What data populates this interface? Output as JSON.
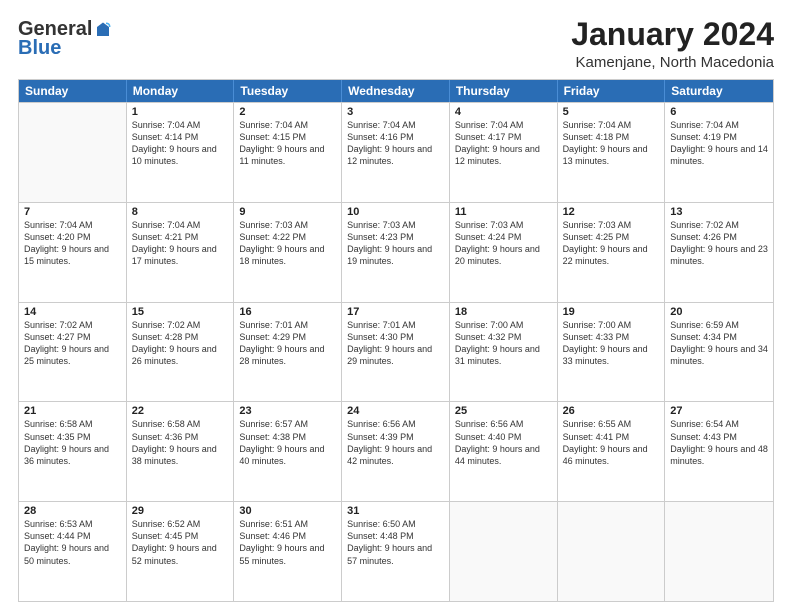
{
  "logo": {
    "general": "General",
    "blue": "Blue"
  },
  "header": {
    "month": "January 2024",
    "location": "Kamenjane, North Macedonia"
  },
  "days": [
    "Sunday",
    "Monday",
    "Tuesday",
    "Wednesday",
    "Thursday",
    "Friday",
    "Saturday"
  ],
  "weeks": [
    [
      {
        "day": "",
        "sunrise": "",
        "sunset": "",
        "daylight": "",
        "empty": true
      },
      {
        "day": "1",
        "sunrise": "Sunrise: 7:04 AM",
        "sunset": "Sunset: 4:14 PM",
        "daylight": "Daylight: 9 hours and 10 minutes."
      },
      {
        "day": "2",
        "sunrise": "Sunrise: 7:04 AM",
        "sunset": "Sunset: 4:15 PM",
        "daylight": "Daylight: 9 hours and 11 minutes."
      },
      {
        "day": "3",
        "sunrise": "Sunrise: 7:04 AM",
        "sunset": "Sunset: 4:16 PM",
        "daylight": "Daylight: 9 hours and 12 minutes."
      },
      {
        "day": "4",
        "sunrise": "Sunrise: 7:04 AM",
        "sunset": "Sunset: 4:17 PM",
        "daylight": "Daylight: 9 hours and 12 minutes."
      },
      {
        "day": "5",
        "sunrise": "Sunrise: 7:04 AM",
        "sunset": "Sunset: 4:18 PM",
        "daylight": "Daylight: 9 hours and 13 minutes."
      },
      {
        "day": "6",
        "sunrise": "Sunrise: 7:04 AM",
        "sunset": "Sunset: 4:19 PM",
        "daylight": "Daylight: 9 hours and 14 minutes."
      }
    ],
    [
      {
        "day": "7",
        "sunrise": "Sunrise: 7:04 AM",
        "sunset": "Sunset: 4:20 PM",
        "daylight": "Daylight: 9 hours and 15 minutes."
      },
      {
        "day": "8",
        "sunrise": "Sunrise: 7:04 AM",
        "sunset": "Sunset: 4:21 PM",
        "daylight": "Daylight: 9 hours and 17 minutes."
      },
      {
        "day": "9",
        "sunrise": "Sunrise: 7:03 AM",
        "sunset": "Sunset: 4:22 PM",
        "daylight": "Daylight: 9 hours and 18 minutes."
      },
      {
        "day": "10",
        "sunrise": "Sunrise: 7:03 AM",
        "sunset": "Sunset: 4:23 PM",
        "daylight": "Daylight: 9 hours and 19 minutes."
      },
      {
        "day": "11",
        "sunrise": "Sunrise: 7:03 AM",
        "sunset": "Sunset: 4:24 PM",
        "daylight": "Daylight: 9 hours and 20 minutes."
      },
      {
        "day": "12",
        "sunrise": "Sunrise: 7:03 AM",
        "sunset": "Sunset: 4:25 PM",
        "daylight": "Daylight: 9 hours and 22 minutes."
      },
      {
        "day": "13",
        "sunrise": "Sunrise: 7:02 AM",
        "sunset": "Sunset: 4:26 PM",
        "daylight": "Daylight: 9 hours and 23 minutes."
      }
    ],
    [
      {
        "day": "14",
        "sunrise": "Sunrise: 7:02 AM",
        "sunset": "Sunset: 4:27 PM",
        "daylight": "Daylight: 9 hours and 25 minutes."
      },
      {
        "day": "15",
        "sunrise": "Sunrise: 7:02 AM",
        "sunset": "Sunset: 4:28 PM",
        "daylight": "Daylight: 9 hours and 26 minutes."
      },
      {
        "day": "16",
        "sunrise": "Sunrise: 7:01 AM",
        "sunset": "Sunset: 4:29 PM",
        "daylight": "Daylight: 9 hours and 28 minutes."
      },
      {
        "day": "17",
        "sunrise": "Sunrise: 7:01 AM",
        "sunset": "Sunset: 4:30 PM",
        "daylight": "Daylight: 9 hours and 29 minutes."
      },
      {
        "day": "18",
        "sunrise": "Sunrise: 7:00 AM",
        "sunset": "Sunset: 4:32 PM",
        "daylight": "Daylight: 9 hours and 31 minutes."
      },
      {
        "day": "19",
        "sunrise": "Sunrise: 7:00 AM",
        "sunset": "Sunset: 4:33 PM",
        "daylight": "Daylight: 9 hours and 33 minutes."
      },
      {
        "day": "20",
        "sunrise": "Sunrise: 6:59 AM",
        "sunset": "Sunset: 4:34 PM",
        "daylight": "Daylight: 9 hours and 34 minutes."
      }
    ],
    [
      {
        "day": "21",
        "sunrise": "Sunrise: 6:58 AM",
        "sunset": "Sunset: 4:35 PM",
        "daylight": "Daylight: 9 hours and 36 minutes."
      },
      {
        "day": "22",
        "sunrise": "Sunrise: 6:58 AM",
        "sunset": "Sunset: 4:36 PM",
        "daylight": "Daylight: 9 hours and 38 minutes."
      },
      {
        "day": "23",
        "sunrise": "Sunrise: 6:57 AM",
        "sunset": "Sunset: 4:38 PM",
        "daylight": "Daylight: 9 hours and 40 minutes."
      },
      {
        "day": "24",
        "sunrise": "Sunrise: 6:56 AM",
        "sunset": "Sunset: 4:39 PM",
        "daylight": "Daylight: 9 hours and 42 minutes."
      },
      {
        "day": "25",
        "sunrise": "Sunrise: 6:56 AM",
        "sunset": "Sunset: 4:40 PM",
        "daylight": "Daylight: 9 hours and 44 minutes."
      },
      {
        "day": "26",
        "sunrise": "Sunrise: 6:55 AM",
        "sunset": "Sunset: 4:41 PM",
        "daylight": "Daylight: 9 hours and 46 minutes."
      },
      {
        "day": "27",
        "sunrise": "Sunrise: 6:54 AM",
        "sunset": "Sunset: 4:43 PM",
        "daylight": "Daylight: 9 hours and 48 minutes."
      }
    ],
    [
      {
        "day": "28",
        "sunrise": "Sunrise: 6:53 AM",
        "sunset": "Sunset: 4:44 PM",
        "daylight": "Daylight: 9 hours and 50 minutes."
      },
      {
        "day": "29",
        "sunrise": "Sunrise: 6:52 AM",
        "sunset": "Sunset: 4:45 PM",
        "daylight": "Daylight: 9 hours and 52 minutes."
      },
      {
        "day": "30",
        "sunrise": "Sunrise: 6:51 AM",
        "sunset": "Sunset: 4:46 PM",
        "daylight": "Daylight: 9 hours and 55 minutes."
      },
      {
        "day": "31",
        "sunrise": "Sunrise: 6:50 AM",
        "sunset": "Sunset: 4:48 PM",
        "daylight": "Daylight: 9 hours and 57 minutes."
      },
      {
        "day": "",
        "sunrise": "",
        "sunset": "",
        "daylight": "",
        "empty": true
      },
      {
        "day": "",
        "sunrise": "",
        "sunset": "",
        "daylight": "",
        "empty": true
      },
      {
        "day": "",
        "sunrise": "",
        "sunset": "",
        "daylight": "",
        "empty": true
      }
    ]
  ]
}
